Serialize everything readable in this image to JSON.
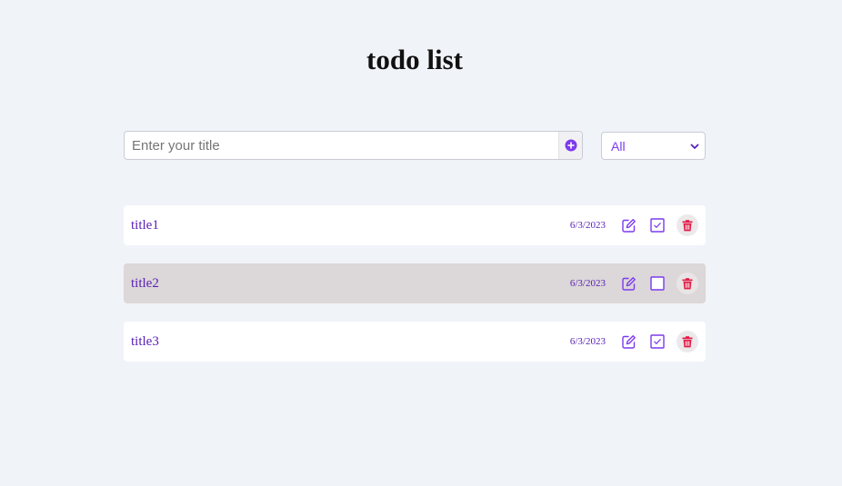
{
  "app": {
    "title": "todo list"
  },
  "form": {
    "title_placeholder": "Enter your title",
    "add_icon": "plus-circle-icon"
  },
  "filter": {
    "selected": "All",
    "options": [
      "All"
    ]
  },
  "todos": [
    {
      "title": "title1",
      "date": "6/3/2023",
      "completed": true
    },
    {
      "title": "title2",
      "date": "6/3/2023",
      "completed": false
    },
    {
      "title": "title3",
      "date": "6/3/2023",
      "completed": true
    }
  ],
  "colors": {
    "accent": "#7c3aed",
    "text_purple": "#5b21b6",
    "delete_red": "#e11d48",
    "background": "#f0f3f8",
    "incomplete_row": "#dcd7d8"
  },
  "icons": {
    "edit": "pencil-square-icon",
    "check": "checkbox-icon",
    "delete": "trash-icon"
  }
}
